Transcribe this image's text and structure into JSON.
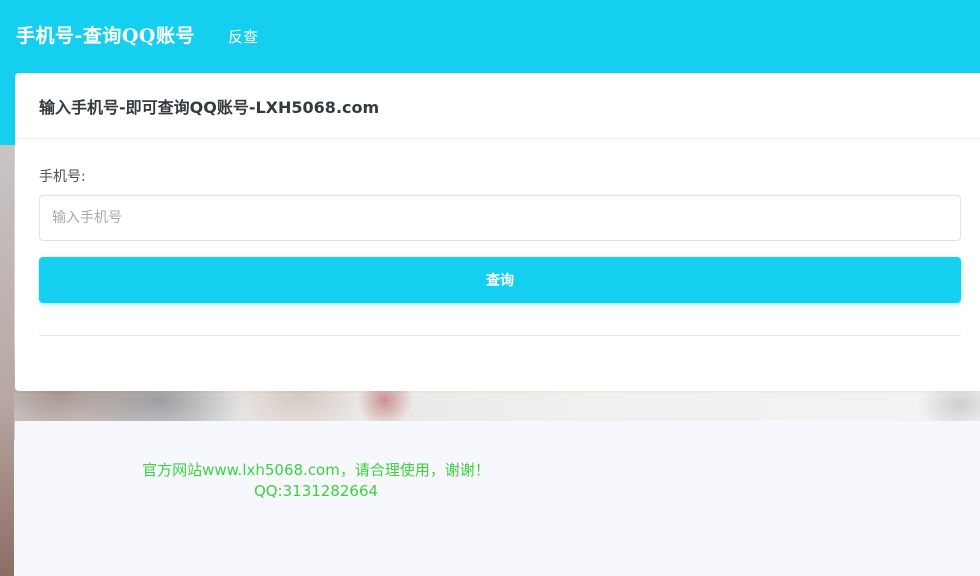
{
  "navbar": {
    "title": "手机号-查询QQ账号",
    "reverse_link": "反查"
  },
  "card": {
    "title": "输入手机号-即可查询QQ账号-LXH5068.com",
    "phone_label": "手机号:",
    "phone_placeholder": "输入手机号",
    "phone_value": "",
    "query_button": "查询"
  },
  "footer": {
    "line1": "官方网站www.lxh5068.com，请合理使用，谢谢！",
    "line2": "QQ:3131282664"
  },
  "colors": {
    "accent": "#14cff0",
    "footer_text": "#3ed13e"
  }
}
